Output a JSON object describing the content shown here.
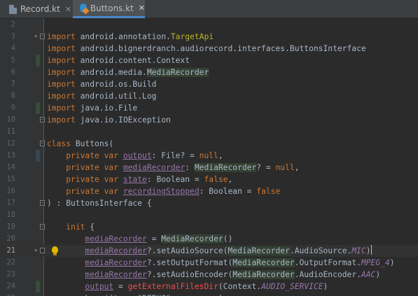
{
  "tabs": [
    {
      "label": "Record.kt",
      "icon": "kotlin-file-icon",
      "active": false,
      "close": "✕"
    },
    {
      "label": "Buttons.kt",
      "icon": "kotlin-class-icon",
      "active": true,
      "close": "✕"
    }
  ],
  "editor": {
    "current_line": 21,
    "lines": [
      {
        "num": "2",
        "tokens": []
      },
      {
        "num": "3",
        "tokens": [
          {
            "t": "import ",
            "c": "kw"
          },
          {
            "t": "android.annotation."
          },
          {
            "t": "TargetApi",
            "c": "ann"
          }
        ]
      },
      {
        "num": "4",
        "tokens": [
          {
            "t": "import ",
            "c": "kw"
          },
          {
            "t": "android.bignerdranch.audiorecord.interfaces.ButtonsInterface"
          }
        ]
      },
      {
        "num": "5",
        "tokens": [
          {
            "t": "import ",
            "c": "kw"
          },
          {
            "t": "android.content.Context"
          }
        ]
      },
      {
        "num": "6",
        "tokens": [
          {
            "t": "import ",
            "c": "kw"
          },
          {
            "t": "android.media."
          },
          {
            "t": "MediaRecorder",
            "c": "typehl"
          }
        ]
      },
      {
        "num": "7",
        "tokens": [
          {
            "t": "import ",
            "c": "kw"
          },
          {
            "t": "android.os.Build"
          }
        ]
      },
      {
        "num": "8",
        "tokens": [
          {
            "t": "import ",
            "c": "kw"
          },
          {
            "t": "android.util.Log"
          }
        ]
      },
      {
        "num": "9",
        "tokens": [
          {
            "t": "import ",
            "c": "kw"
          },
          {
            "t": "java.io.File"
          }
        ]
      },
      {
        "num": "10",
        "tokens": [
          {
            "t": "import ",
            "c": "kw"
          },
          {
            "t": "java.io.IOException"
          }
        ]
      },
      {
        "num": "11",
        "tokens": []
      },
      {
        "num": "12",
        "tokens": [
          {
            "t": "class ",
            "c": "kw"
          },
          {
            "t": "Buttons("
          }
        ]
      },
      {
        "num": "13",
        "tokens": [
          {
            "t": "    private var ",
            "c": "kw"
          },
          {
            "t": "output",
            "c": "prop"
          },
          {
            "t": ": File? = "
          },
          {
            "t": "null",
            "c": "kw"
          },
          {
            "t": ","
          }
        ]
      },
      {
        "num": "14",
        "tokens": [
          {
            "t": "    private var ",
            "c": "kw"
          },
          {
            "t": "mediaRecorder",
            "c": "prop"
          },
          {
            "t": ": "
          },
          {
            "t": "MediaRecorder",
            "c": "typehl"
          },
          {
            "t": "? = "
          },
          {
            "t": "null",
            "c": "kw"
          },
          {
            "t": ","
          }
        ]
      },
      {
        "num": "15",
        "tokens": [
          {
            "t": "    private var ",
            "c": "kw"
          },
          {
            "t": "state",
            "c": "prop"
          },
          {
            "t": ": Boolean = "
          },
          {
            "t": "false",
            "c": "kw"
          },
          {
            "t": ","
          }
        ]
      },
      {
        "num": "16",
        "tokens": [
          {
            "t": "    private var ",
            "c": "kw"
          },
          {
            "t": "recordingStopped",
            "c": "prop"
          },
          {
            "t": ": Boolean = "
          },
          {
            "t": "false",
            "c": "kw"
          }
        ]
      },
      {
        "num": "17",
        "tokens": [
          {
            "t": ") : ButtonsInterface {"
          }
        ]
      },
      {
        "num": "18",
        "tokens": []
      },
      {
        "num": "19",
        "tokens": [
          {
            "t": "    "
          },
          {
            "t": "init",
            "c": "kw"
          },
          {
            "t": " {"
          }
        ]
      },
      {
        "num": "20",
        "tokens": [
          {
            "t": "        "
          },
          {
            "t": "mediaRecorder",
            "c": "prop"
          },
          {
            "t": " = "
          },
          {
            "t": "MediaRecorder",
            "c": "typehl"
          },
          {
            "t": "()"
          }
        ]
      },
      {
        "num": "21",
        "tokens": [
          {
            "t": "        "
          },
          {
            "t": "mediaRecorder",
            "c": "prop"
          },
          {
            "t": "?.setAudioSource("
          },
          {
            "t": "MediaRecorder",
            "c": "typehl"
          },
          {
            "t": ".AudioSource."
          },
          {
            "t": "MIC",
            "c": "propi"
          },
          {
            "t": ")"
          }
        ]
      },
      {
        "num": "22",
        "tokens": [
          {
            "t": "        "
          },
          {
            "t": "mediaRecorder",
            "c": "prop"
          },
          {
            "t": "?.setOutputFormat("
          },
          {
            "t": "MediaRecorder",
            "c": "typehl"
          },
          {
            "t": ".OutputFormat."
          },
          {
            "t": "MPEG_4",
            "c": "propi"
          },
          {
            "t": ")"
          }
        ]
      },
      {
        "num": "23",
        "tokens": [
          {
            "t": "        "
          },
          {
            "t": "mediaRecorder",
            "c": "prop"
          },
          {
            "t": "?.setAudioEncoder("
          },
          {
            "t": "MediaRecorder",
            "c": "typehl"
          },
          {
            "t": ".AudioEncoder."
          },
          {
            "t": "AAC",
            "c": "propi"
          },
          {
            "t": ")"
          }
        ]
      },
      {
        "num": "24",
        "tokens": [
          {
            "t": "        "
          },
          {
            "t": "output",
            "c": "prop"
          },
          {
            "t": " = "
          },
          {
            "t": "getExternalFilesDir",
            "c": "err"
          },
          {
            "t": "(Context."
          },
          {
            "t": "AUDIO_SERVICE",
            "c": "propi"
          },
          {
            "t": ")"
          }
        ]
      },
      {
        "num": "25",
        "tokens": [
          {
            "t": "        "
          },
          {
            "t": "Log.i(tag: \"DEBUG\", msg: ...)"
          }
        ]
      }
    ]
  }
}
